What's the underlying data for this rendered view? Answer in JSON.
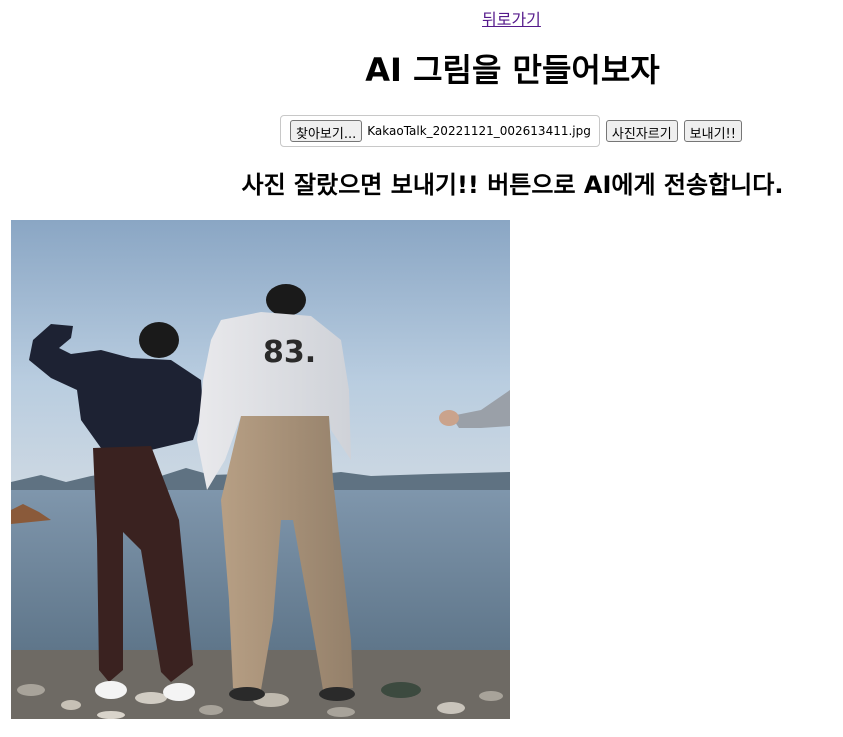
{
  "nav": {
    "back_link": "뒤로가기"
  },
  "page": {
    "title": "AI 그림을 만들어보자"
  },
  "upload": {
    "browse_label": "찾아보기...",
    "file_name": "KakaoTalk_20221121_002613411.jpg",
    "crop_label": "사진자르기",
    "send_label": "보내기!!"
  },
  "instruction": {
    "text": "사진 잘랐으면 보내기!! 버튼으로 AI에게 전송합니다."
  },
  "photo": {
    "description_icon": "uploaded-photo"
  }
}
